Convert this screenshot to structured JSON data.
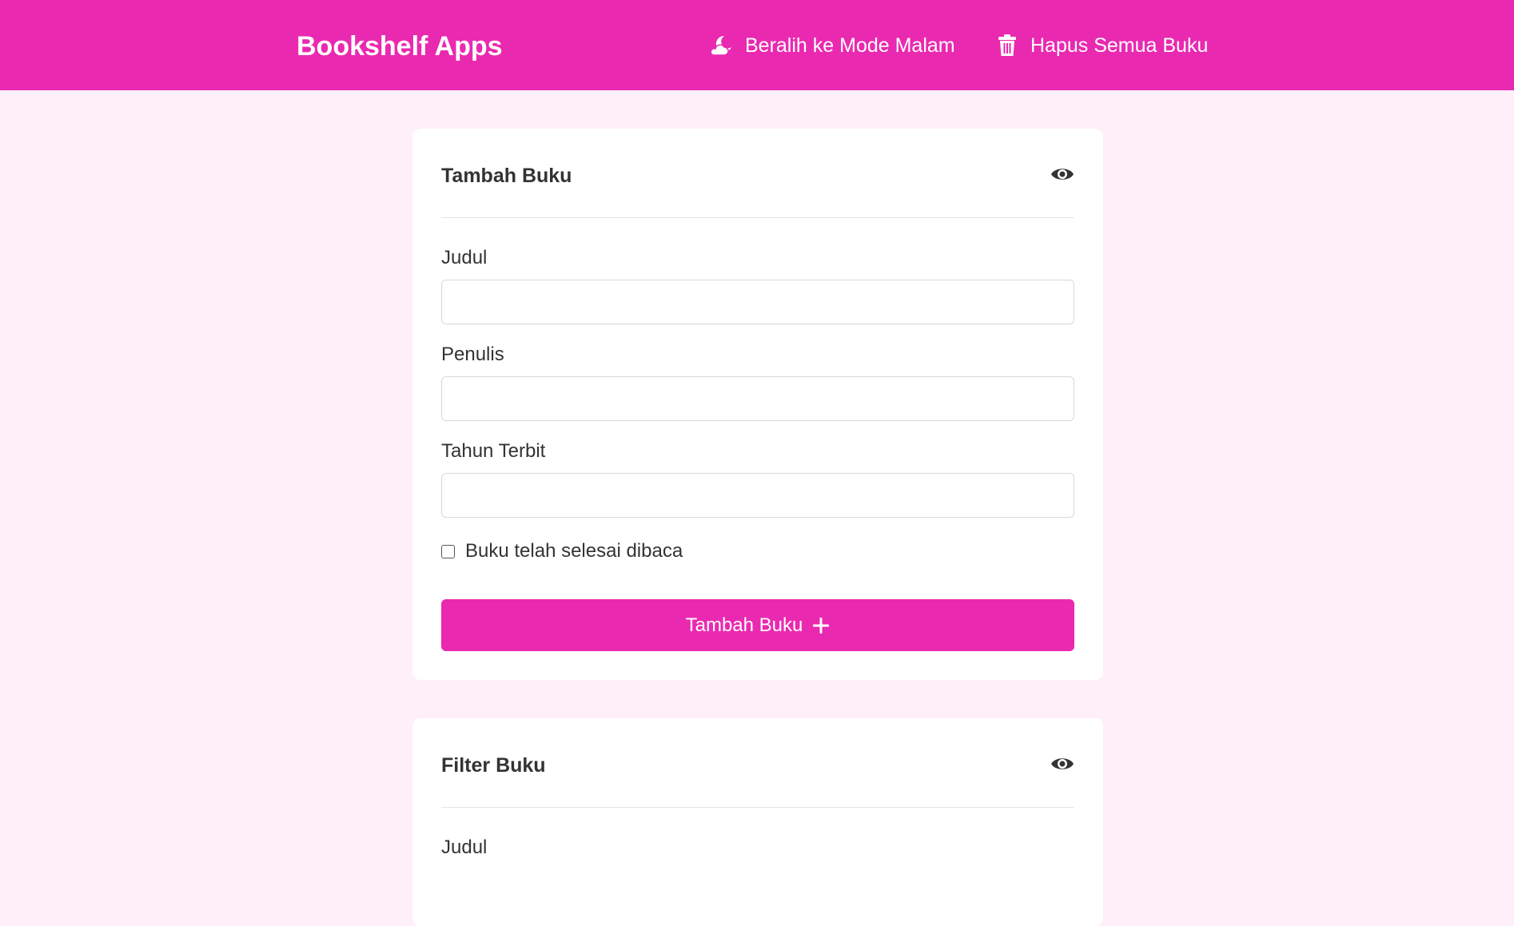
{
  "navbar": {
    "brand": "Bookshelf Apps",
    "night_mode_label": "Beralih ke Mode Malam",
    "night_mode_icon": "cloud-moon-icon",
    "delete_all_label": "Hapus Semua Buku",
    "delete_all_icon": "trash-icon"
  },
  "add_form": {
    "title": "Tambah Buku",
    "toggle_icon": "eye-icon",
    "title_label": "Judul",
    "title_value": "",
    "author_label": "Penulis",
    "author_value": "",
    "year_label": "Tahun Terbit",
    "year_value": "",
    "finished_label": "Buku telah selesai dibaca",
    "finished_checked": false,
    "submit_label": "Tambah Buku",
    "submit_icon": "plus-icon"
  },
  "filter_form": {
    "title": "Filter Buku",
    "toggle_icon": "eye-icon",
    "title_label": "Judul"
  },
  "colors": {
    "accent": "#ea29b1",
    "background": "#ffeff9",
    "card": "#ffffff",
    "text": "#333333"
  }
}
